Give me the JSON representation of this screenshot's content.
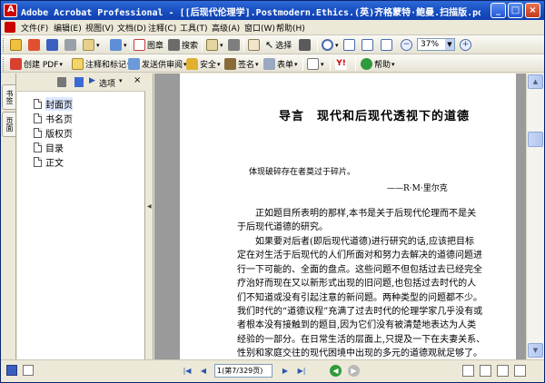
{
  "window": {
    "title": "Adobe Acrobat Professional - [[后现代伦理学].Postmodern.Ethics.(英)齐格蒙特·鲍曼.扫描版.pdf]",
    "controls": {
      "minimize": "_",
      "maximize": "□",
      "close": "×"
    }
  },
  "menu": {
    "items": [
      "文件(F)",
      "编辑(E)",
      "视图(V)",
      "文档(D)",
      "注释(C)",
      "工具(T)",
      "高级(A)",
      "窗口(W)",
      "帮助(H)"
    ]
  },
  "toolbar1": {
    "image_label": "图章",
    "search_label": "搜索",
    "select_label": "选择",
    "zoom_value": "37%"
  },
  "toolbar2": {
    "create_pdf_label": "创建 PDF",
    "comment_label": "注释和标记",
    "review_label": "发送供审阅",
    "secure_label": "安全",
    "sign_label": "签名",
    "forms_label": "表单",
    "help_label": "帮助"
  },
  "side_tabs": {
    "bookmarks": "书签",
    "pages": "页面"
  },
  "bookmarks_panel": {
    "options_label": "选项",
    "items": [
      {
        "label": "封面页",
        "selected": true
      },
      {
        "label": "书名页",
        "selected": false
      },
      {
        "label": "版权页",
        "selected": false
      },
      {
        "label": "目录",
        "selected": false
      },
      {
        "label": "正文",
        "selected": false
      }
    ]
  },
  "document": {
    "chapter_title": "导言　现代和后现代透视下的道德",
    "epigraph": "体现破碎存在者莫过于碎片。",
    "epigraph_author": "——R·M·里尔克",
    "paragraph1": [
      "　　正如题目所表明的那样,本书是关于后现代伦理而不是关",
      "于后现代道德的研究。"
    ],
    "paragraph2": [
      "　　如果要对后者(即后现代道德)进行研究的话,应该把目标",
      "定在对生活于后现代的人们所面对和努力去解决的道德问题进",
      "行一下可能的、全面的盘点。这些问题不但包括过去已经完全",
      "疗治好而现在又以新形式出现的旧问题,也包括过去时代的人",
      "们不知道或没有引起注意的新问题。两种类型的问题都不少。",
      "我们时代的“道德议程”充满了过去时代的伦理学家几乎没有或",
      "者根本没有接触到的题目,因为它们没有被清楚地表达为人类",
      "经验的一部分。在日常生活的层面上,只提及一下在夫妻关系、",
      "性别和家庭交往的现代困境中出现的多元的道德观就足够了。"
    ]
  },
  "status": {
    "page_indicator": "1(第7/329页)"
  },
  "colors": {
    "title_bar": "#1c54c6",
    "chrome": "#ece9d8",
    "doc_background": "#9a9a9a",
    "status_green": "#2e9a3a"
  }
}
